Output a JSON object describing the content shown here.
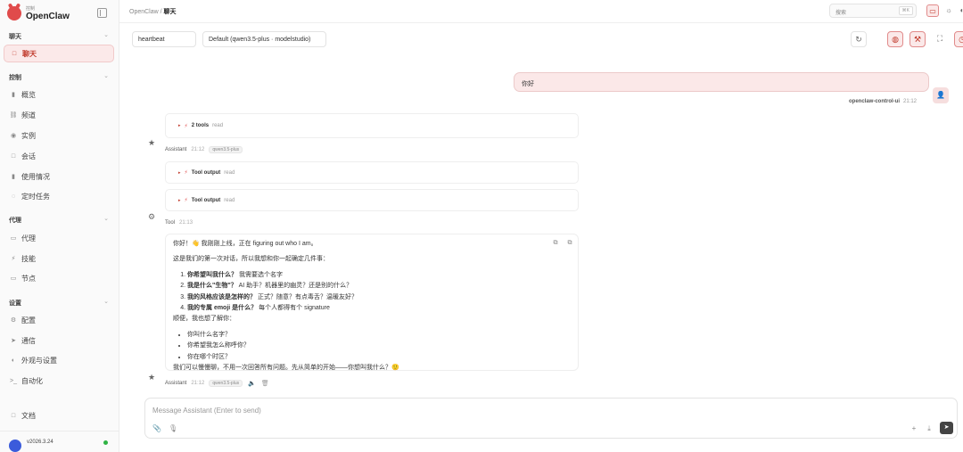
{
  "brand": {
    "subtitle": "控制",
    "name": "OpenClaw"
  },
  "sidebar": {
    "sections": [
      {
        "label": "聊天"
      },
      {
        "label": "控制"
      },
      {
        "label": "代理"
      },
      {
        "label": "设置"
      }
    ],
    "items": [
      {
        "label": "聊天",
        "icon": "□"
      },
      {
        "label": "概览",
        "icon": "▮"
      },
      {
        "label": "频道",
        "icon": "⛓"
      },
      {
        "label": "实例",
        "icon": "◉"
      },
      {
        "label": "会话",
        "icon": "□"
      },
      {
        "label": "使用情况",
        "icon": "▮"
      },
      {
        "label": "定时任务",
        "icon": "◌"
      },
      {
        "label": "代理",
        "icon": "▭"
      },
      {
        "label": "技能",
        "icon": "⚡"
      },
      {
        "label": "节点",
        "icon": "▭"
      },
      {
        "label": "配置",
        "icon": "⚙"
      },
      {
        "label": "通信",
        "icon": "➤"
      },
      {
        "label": "外观与设置",
        "icon": "◐"
      },
      {
        "label": "自动化",
        "icon": ">_"
      },
      {
        "label": "文档",
        "icon": "□"
      }
    ],
    "version": "v2026.3.24"
  },
  "topbar": {
    "breadcrumb_root": "OpenClaw",
    "breadcrumb_sep": "/",
    "breadcrumb_current": "聊天",
    "search_placeholder": "搜索",
    "search_shortcut": "⌘K"
  },
  "toolbar": {
    "session": "heartbeat",
    "model": "Default (qwen3.5-plus · modelstudio)"
  },
  "messages": {
    "user_text": "你好",
    "user_name": "openclaw-control-ui",
    "user_time": "21:12",
    "tools_summary_count": "2 tools",
    "tools_summary_tag": "read",
    "assistant_label": "Assistant",
    "assistant_time": "21:12",
    "model_tag": "qwen3.5-plus",
    "tool_output_label": "Tool output",
    "tool_output_tag": "read",
    "tool_label": "Tool",
    "tool_time": "21:13",
    "answer_greeting": "你好！👋 我刚刚上线，正在 figuring out who I am。",
    "answer_intro": "这是我们的第一次对话，所以我想和你一起确定几件事：",
    "q1_bold": "你希望叫我什么？",
    "q1_rest": " 我需要选个名字",
    "q2_bold": "我是什么\"生物\"？",
    "q2_rest": " AI 助手？机器里的幽灵？还是别的什么？",
    "q3_bold": "我的风格应该是怎样的？",
    "q3_rest": " 正式？随意？有点毒舌？温暖友好？",
    "q4_bold": "我的专属 emoji 是什么？",
    "q4_rest": " 每个人都得有个 signature",
    "also": "顺便，我也想了解你：",
    "b1": "你叫什么名字？",
    "b2": "你希望我怎么称呼你？",
    "b3": "你在哪个时区？",
    "closing": "我们可以慢慢聊，不用一次回答所有问题。先从简单的开始——你想叫我什么？🙂"
  },
  "composer": {
    "placeholder": "Message Assistant (Enter to send)"
  },
  "colors": {
    "accent": "#c0392b",
    "accent_bg": "#fbe9e9",
    "online": "#2fb344"
  }
}
